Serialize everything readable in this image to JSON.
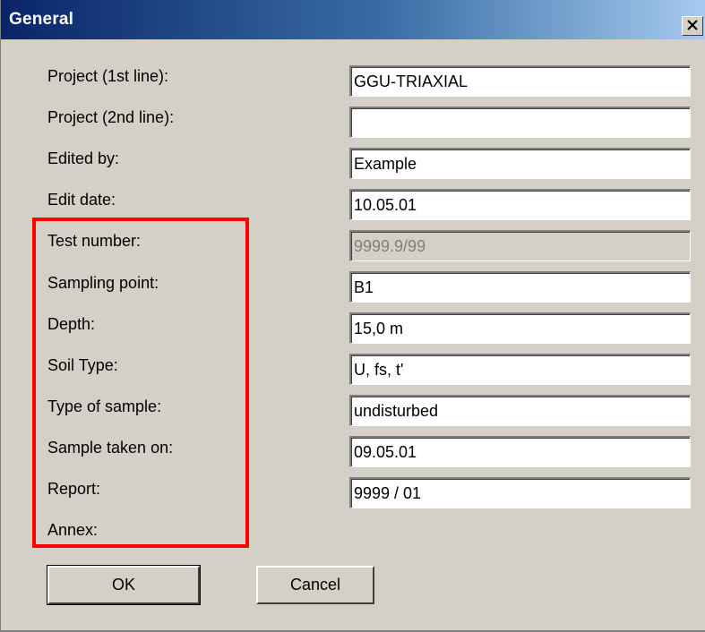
{
  "window": {
    "title": "General",
    "close_label": "close"
  },
  "form": {
    "rows": [
      {
        "label": "Project (1st line):",
        "value": "GGU-TRIAXIAL",
        "disabled": false
      },
      {
        "label": "Project (2nd line):",
        "value": "",
        "disabled": false
      },
      {
        "label": "Edited by:",
        "value": "Example",
        "disabled": false
      },
      {
        "label": "Edit date:",
        "value": "10.05.01",
        "disabled": false
      },
      {
        "label": "Test number:",
        "value": "9999.9/99",
        "disabled": true
      },
      {
        "label": "Sampling point:",
        "value": "B1",
        "disabled": false
      },
      {
        "label": "Depth:",
        "value": "15,0 m",
        "disabled": false
      },
      {
        "label": "Soil Type:",
        "value": "U, fs, t'",
        "disabled": false
      },
      {
        "label": "Type of sample:",
        "value": "undisturbed",
        "disabled": false
      },
      {
        "label": "Sample taken on:",
        "value": "09.05.01",
        "disabled": false
      },
      {
        "label": "Report:",
        "value": "9999 / 01",
        "disabled": false
      },
      {
        "label": "Annex:"
      }
    ]
  },
  "buttons": {
    "ok_label": "OK",
    "cancel_label": "Cancel"
  },
  "highlight_color": "#ff0000",
  "titlebar_color": "#0a246a"
}
